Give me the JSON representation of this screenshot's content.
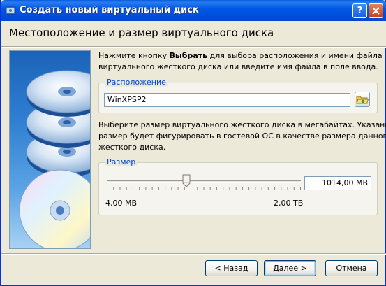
{
  "window": {
    "title": "Создать новый виртуальный диск"
  },
  "header": {
    "title": "Местоположение и размер виртуального диска"
  },
  "location_section": {
    "desc_prefix": "Нажмите кнопку ",
    "desc_bold": "Выбрать",
    "desc_rest_line1": " для выбора расположения и имени файла",
    "desc_line2": "виртуального жесткого диска или введите имя файла в поле ввода.",
    "group_label": "Расположение",
    "file_name": "WinXPSP2",
    "choose_button_icon": "folder-icon"
  },
  "size_section": {
    "desc_line1": "Выберите размер виртуального жесткого диска в мегабайтах. Указанный",
    "desc_line2": "размер будет фигурировать в гостевой ОС в качестве размера данного",
    "desc_line3": "жесткого диска.",
    "group_label": "Размер",
    "value": "1014,00 MB",
    "min_label": "4,00 MB",
    "max_label": "2,00 TB",
    "slider_fraction": 0.41
  },
  "footer": {
    "back_label": "< Назад",
    "next_label": "Далее >",
    "cancel_label": "Отмена"
  },
  "colors": {
    "titlebar": "#0058e6",
    "group_label": "#0046d5",
    "dialog_bg": "#ece9d8"
  }
}
